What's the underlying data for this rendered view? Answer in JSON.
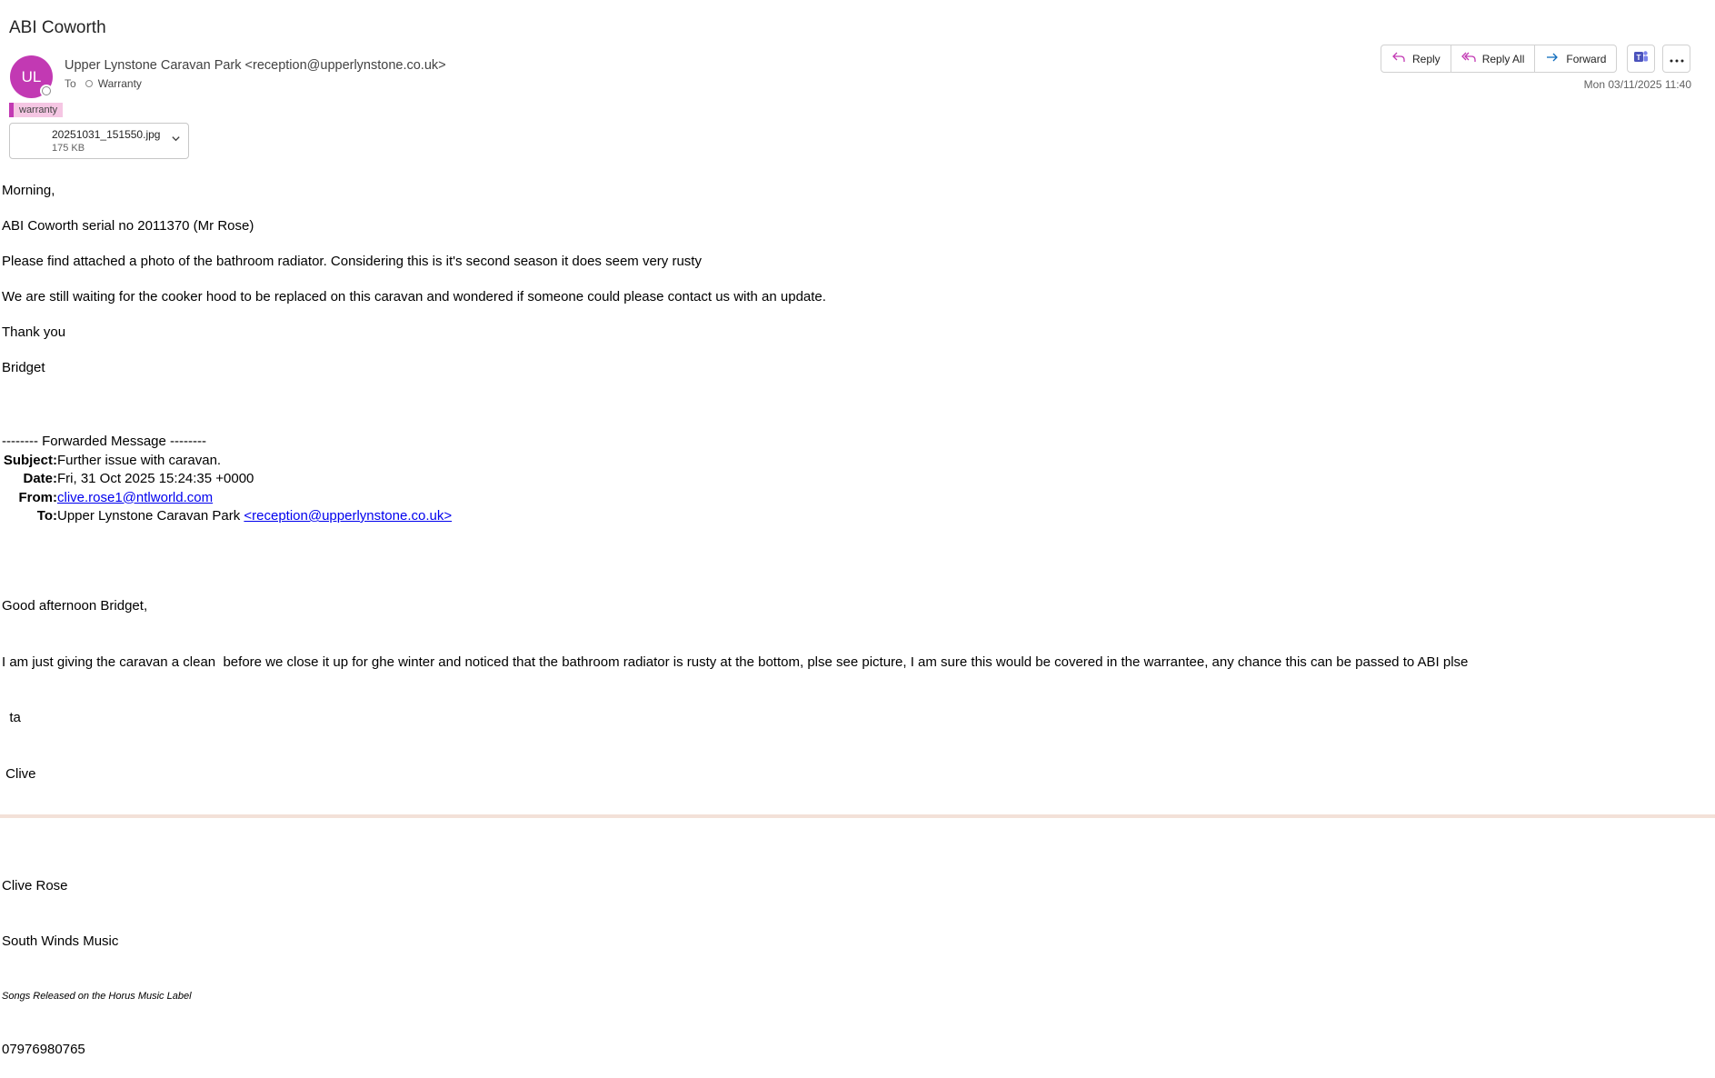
{
  "subject": "ABI Coworth",
  "sender": {
    "initials": "UL",
    "display": "Upper Lynstone Caravan Park <reception@upperlynstone.co.uk>",
    "color": "#c239b3"
  },
  "to": {
    "label": "To",
    "recipient": "Warranty"
  },
  "category": "warranty",
  "attachment": {
    "name": "20251031_151550.jpg",
    "size": "175 KB"
  },
  "actions": {
    "reply": "Reply",
    "reply_all": "Reply All",
    "forward": "Forward"
  },
  "datetime": "Mon 03/11/2025 11:40",
  "body": {
    "greeting": "Morning,",
    "serial": "ABI Coworth serial no 2011370 (Mr Rose)",
    "p1": "Please find attached a photo of the bathroom radiator. Considering this is it's second season it does seem very rusty",
    "p2": "We are still waiting for the cooker hood to be replaced on this caravan and wondered if someone could please contact us with an update.",
    "thanks": "Thank you",
    "name": "Bridget"
  },
  "forwarded": {
    "header": "-------- Forwarded Message --------",
    "subject_label": "Subject:",
    "subject": "Further issue with caravan.",
    "date_label": "Date:",
    "date": "Fri, 31 Oct 2025 15:24:35 +0000",
    "from_label": "From:",
    "from": "clive.rose1@ntlworld.com",
    "to_label": "To:",
    "to_name": "Upper Lynstone Caravan Park ",
    "to_email": "<reception@upperlynstone.co.uk>"
  },
  "original": {
    "greeting": "Good afternoon Bridget,",
    "line1": "I am just giving the caravan a clean  before we close it up for ghe winter and noticed that the bathroom radiator is rusty at the bottom, plse see picture, I am sure this would be covered in the warrantee, any chance this can be passed to ABI plse",
    "line2": "  ta",
    "line3": " Clive",
    "sig_name": "Clive Rose",
    "sig_company": "South Winds Music",
    "sig_tagline": "Songs Released on the Horus Music Label",
    "sig_phone": "07976980765"
  }
}
